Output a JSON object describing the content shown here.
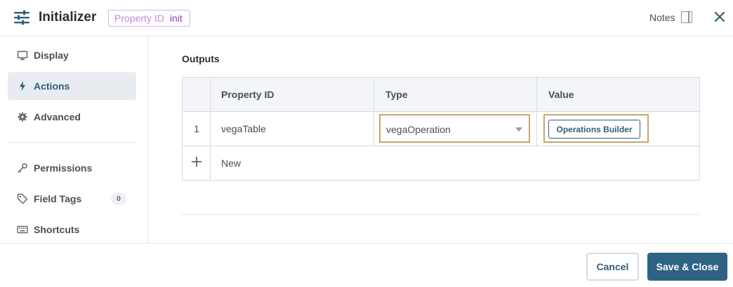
{
  "header": {
    "title": "Initializer",
    "property_id_label": "Property ID",
    "property_id_value": "init",
    "notes_label": "Notes",
    "menu_icon": "sliders-icon",
    "close_icon": "close-icon"
  },
  "sidebar": {
    "items": [
      {
        "label": "Display",
        "icon": "monitor-icon",
        "active": false
      },
      {
        "label": "Actions",
        "icon": "lightning-icon",
        "active": true
      },
      {
        "label": "Advanced",
        "icon": "gear-icon",
        "active": false
      },
      {
        "label": "Permissions",
        "icon": "key-icon",
        "active": false
      },
      {
        "label": "Field Tags",
        "icon": "tag-icon",
        "active": false,
        "count": "0"
      },
      {
        "label": "Shortcuts",
        "icon": "keyboard-icon",
        "active": false
      }
    ]
  },
  "outputs": {
    "title": "Outputs",
    "columns": [
      "Property ID",
      "Type",
      "Value"
    ],
    "rows": [
      {
        "index": "1",
        "property_id": "vegaTable",
        "type": "vegaOperation",
        "value_button": "Operations Builder"
      }
    ],
    "new_row_label": "New"
  },
  "footer": {
    "cancel_label": "Cancel",
    "save_label": "Save & Close"
  },
  "colors": {
    "accent": "#2f6383",
    "highlight_border": "#c9a66b",
    "badge_text": "#8e3fb0"
  }
}
